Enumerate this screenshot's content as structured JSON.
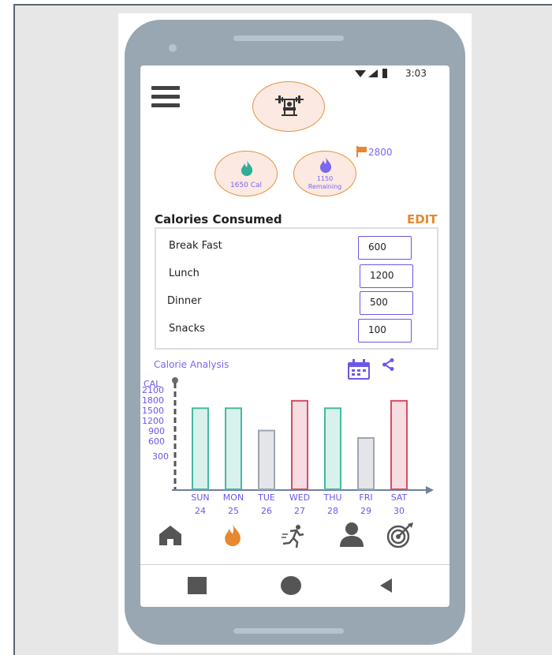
{
  "status_bar": {
    "time": "3:03"
  },
  "summary": {
    "consumed_label": "1650 Cal",
    "remaining_value": "1150",
    "remaining_label": "Remaining",
    "goal_value": "2800"
  },
  "calories": {
    "title": "Calories Consumed",
    "edit_label": "EDIT",
    "meals": [
      {
        "label": "Break Fast",
        "value": "600"
      },
      {
        "label": "Lunch",
        "value": "1200"
      },
      {
        "label": "Dinner",
        "value": "500"
      },
      {
        "label": "Snacks",
        "value": "100"
      }
    ]
  },
  "analysis": {
    "title": "Calorie Analysis"
  },
  "chart_data": {
    "type": "bar",
    "ylabel": "CAL",
    "y_ticks": [
      "2100",
      "1800",
      "1500",
      "1200",
      "900",
      "600",
      "300"
    ],
    "categories": [
      "SUN",
      "MON",
      "TUE",
      "WED",
      "THU",
      "FRI",
      "SAT"
    ],
    "dates": [
      "24",
      "25",
      "26",
      "27",
      "28",
      "29",
      "30"
    ],
    "values": [
      1650,
      1650,
      1200,
      1800,
      1650,
      1050,
      1800
    ],
    "colors": [
      "#d8f1ec",
      "#d8f1ec",
      "#e3e5ea",
      "#f6dde1",
      "#d8f1ec",
      "#e3e5ea",
      "#f6dde1"
    ],
    "borders": [
      "#46b9a2",
      "#46b9a2",
      "#9ea6b0",
      "#d34e63",
      "#46b9a2",
      "#9ea6b0",
      "#d34e63"
    ],
    "ylim": [
      0,
      2100
    ]
  },
  "bottom_nav": [
    "home-icon",
    "flame-icon",
    "running-icon",
    "profile-icon",
    "target-icon"
  ],
  "colors": {
    "accent_orange": "#e7872f",
    "accent_purple": "#7b68ee",
    "teal": "#2fae97"
  }
}
